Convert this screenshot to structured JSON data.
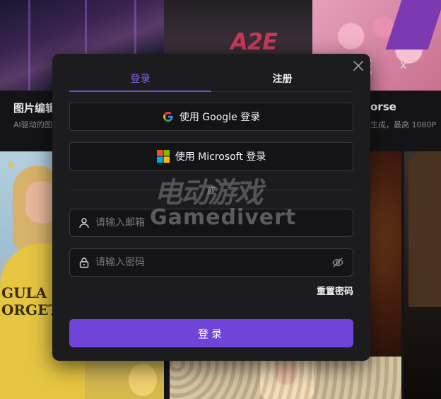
{
  "background": {
    "cards": [
      {
        "title": "图片编辑",
        "desc": "AI驱动的图"
      },
      {
        "title": "orse",
        "desc": "生成，最高 1080P"
      }
    ],
    "tile_texts": {
      "a2e": "A2E",
      "e2x": "²E",
      "x": "x"
    },
    "shirt_text": "GULA\nORGET"
  },
  "modal": {
    "tabs": [
      {
        "label": "登录",
        "active": true
      },
      {
        "label": "注册",
        "active": false
      }
    ],
    "google_button": "使用 Google 登录",
    "microsoft_button": "使用 Microsoft 登录",
    "divider_text": "或",
    "email": {
      "placeholder": "请输入邮箱",
      "value": ""
    },
    "password": {
      "placeholder": "请输入密码",
      "value": ""
    },
    "forgot_password": "重置密码",
    "submit_label": "登录"
  },
  "watermark": {
    "cn": "电动游戏",
    "en": "Gamedivert"
  },
  "colors": {
    "accent": "#6f44d8",
    "tab_active": "#8e63e6",
    "modal_bg": "#1c1c1e",
    "input_bg": "#141416"
  },
  "icons": [
    "close-icon",
    "google-icon",
    "microsoft-icon",
    "user-icon",
    "lock-icon",
    "eye-off-icon"
  ]
}
